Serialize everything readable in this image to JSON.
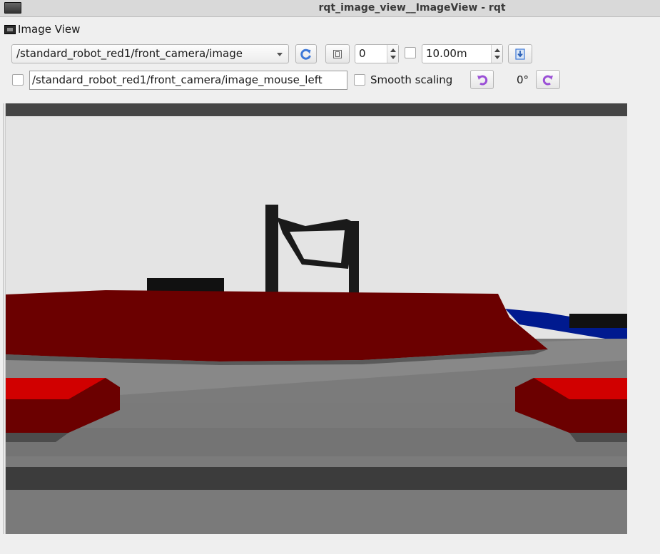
{
  "window": {
    "title": "rqt_image_view__ImageView - rqt"
  },
  "dock": {
    "title": "Image View"
  },
  "toolbar": {
    "topic": "/standard_robot_red1/front_camera/image",
    "refresh_icon": "refresh-icon",
    "spin_value": "0",
    "max_range": "10.00m",
    "save_icon": "save-icon",
    "mouse_topic": "/standard_robot_red1/front_camera/image_mouse_left",
    "smooth_scaling_label": "Smooth scaling",
    "rotate_left_icon": "rotate-left-icon",
    "rotation": "0°",
    "rotate_right_icon": "rotate-right-icon"
  },
  "colors": {
    "accent_blue": "#3d78d8",
    "accent_purple": "#9a4fd6",
    "robot_red": "#6b0000",
    "armor_red": "#d10000",
    "enemy_blue": "#001a8f"
  }
}
